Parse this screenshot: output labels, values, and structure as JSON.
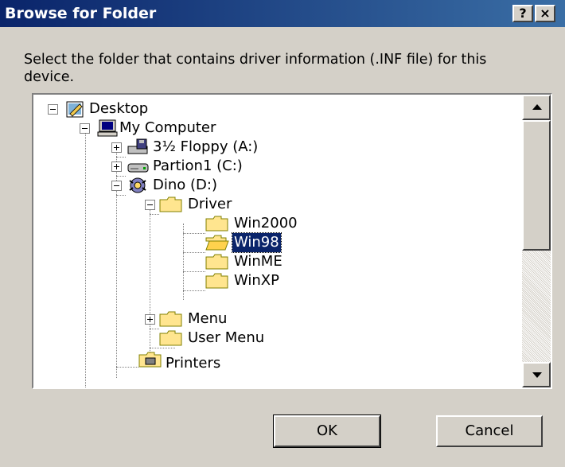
{
  "window": {
    "title": "Browse for Folder",
    "help_label": "?",
    "close_label": "×"
  },
  "instruction": "Select the folder that contains driver information (.INF file) for this device.",
  "tree": {
    "items": [
      {
        "label": "Desktop",
        "icon": "desktop-icon",
        "expanded": true
      },
      {
        "label": "My Computer",
        "icon": "computer-icon",
        "expanded": true
      },
      {
        "label": "3½ Floppy (A:)",
        "icon": "floppy-drive-icon",
        "expanded": false
      },
      {
        "label": "Partion1 (C:)",
        "icon": "hard-drive-icon",
        "expanded": false
      },
      {
        "label": "Dino (D:)",
        "icon": "cd-drive-icon",
        "expanded": true
      },
      {
        "label": "Driver",
        "icon": "folder-icon",
        "expanded": true
      },
      {
        "label": "Win2000",
        "icon": "folder-icon"
      },
      {
        "label": "Win98",
        "icon": "folder-open-icon",
        "selected": true
      },
      {
        "label": "WinME",
        "icon": "folder-icon"
      },
      {
        "label": "WinXP",
        "icon": "folder-icon"
      },
      {
        "label": "Menu",
        "icon": "folder-icon",
        "expanded": false
      },
      {
        "label": "User Menu",
        "icon": "folder-icon"
      },
      {
        "label": "Printers",
        "icon": "printers-folder-icon"
      }
    ]
  },
  "buttons": {
    "ok": "OK",
    "cancel": "Cancel"
  },
  "colors": {
    "titlebar": "#0a246a",
    "selection": "#0a246a",
    "dialog_bg": "#d4d0c8",
    "folder_yellow": "#ffe58f"
  }
}
